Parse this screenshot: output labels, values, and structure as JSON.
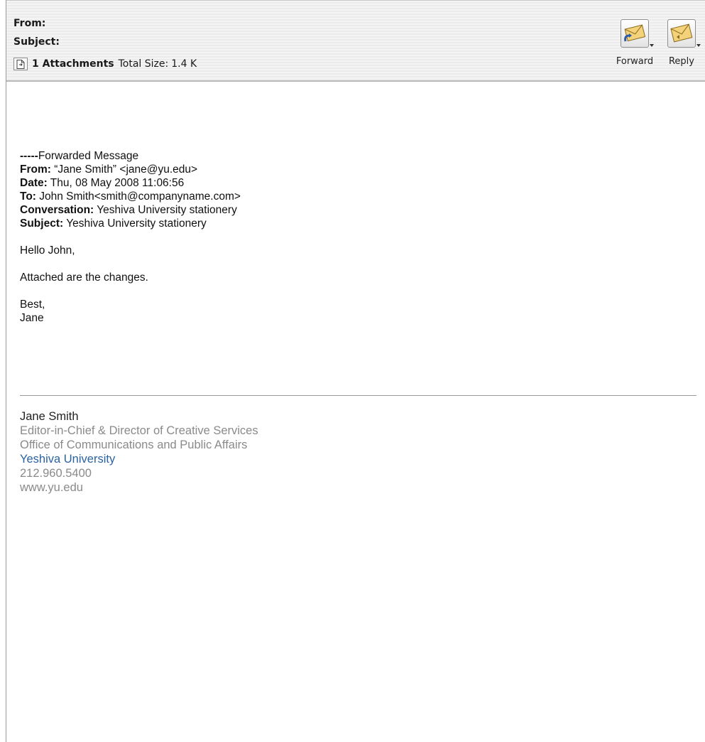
{
  "header": {
    "from_label": "From:",
    "subject_label": "Subject:",
    "attachments_count": "1 Attachments",
    "total_size_label": "Total Size:",
    "total_size_value": "1.4 K"
  },
  "toolbar": {
    "forward_label": "Forward",
    "reply_label": "Reply"
  },
  "message": {
    "forward_dashes": "-----",
    "forward_title": "Forwarded Message",
    "from_label": "From:",
    "from_value": "“Jane Smith” <jane@yu.edu>",
    "date_label": "Date:",
    "date_value": "Thu, 08 May 2008 11:06:56",
    "to_label": "To:",
    "to_value": "John Smith<smith@companyname.com>",
    "conversation_label": "Conversation:",
    "conversation_value": "Yeshiva University stationery",
    "subject_label": "Subject:",
    "subject_value": "Yeshiva University stationery",
    "greeting": "Hello John,",
    "body": "Attached are the changes.",
    "closing": "Best,",
    "closing_name": "Jane"
  },
  "signature": {
    "name": "Jane Smith",
    "title": "Editor-in-Chief & Director of Creative Services",
    "office": "Office of Communications and Public Affairs",
    "university": "Yeshiva University",
    "phone": "212.960.5400",
    "website": "www.yu.edu"
  },
  "colors": {
    "link_blue": "#2a62a3",
    "signature_gray": "#8a8a8a"
  },
  "icons": {
    "attachment": "document-icon",
    "forward": "forward-envelope-icon",
    "reply": "reply-envelope-icon"
  }
}
